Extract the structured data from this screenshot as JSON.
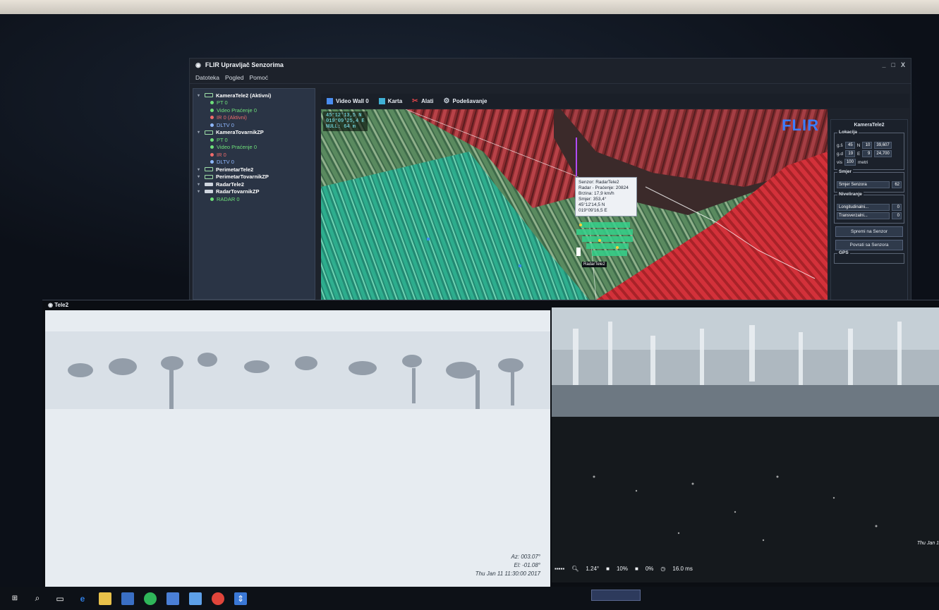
{
  "app": {
    "title": "FLIR Upravljač Senzorima",
    "menu": [
      "Datoteka",
      "Pogled",
      "Pomoć"
    ],
    "window_controls": [
      "_",
      "□",
      "X"
    ]
  },
  "tree": [
    {
      "type": "parent",
      "kind": "cam",
      "label": "KameraTele2 (Aktivni)"
    },
    {
      "type": "child",
      "color": "green",
      "label": "PT 0"
    },
    {
      "type": "child",
      "color": "green",
      "label": "Video Praćenje 0"
    },
    {
      "type": "child",
      "color": "red",
      "label": "IR 0 (Aktivni)"
    },
    {
      "type": "child",
      "color": "blue",
      "label": "DLTV 0"
    },
    {
      "type": "parent",
      "kind": "cam",
      "label": "KameraTovarnikZP"
    },
    {
      "type": "child",
      "color": "green",
      "label": "PT 0"
    },
    {
      "type": "child",
      "color": "green",
      "label": "Video Praćenje 0"
    },
    {
      "type": "child",
      "color": "red",
      "label": "IR 0"
    },
    {
      "type": "child",
      "color": "blue",
      "label": "DLTV 0"
    },
    {
      "type": "parent",
      "kind": "cam",
      "label": "PerimetarTele2"
    },
    {
      "type": "parent",
      "kind": "cam",
      "label": "PerimetarTovarnikZP"
    },
    {
      "type": "parent",
      "kind": "radar",
      "label": "RadarTele2"
    },
    {
      "type": "parent",
      "kind": "radar",
      "label": "RadarTovarnikZP"
    },
    {
      "type": "child",
      "color": "green",
      "label": "RADAR 0"
    }
  ],
  "tabs": [
    "Video Wall 0",
    "Karta",
    "Alati",
    "Podešavanje"
  ],
  "map": {
    "coords": [
      "45°12'13,5 N",
      "019°09'25,4 E",
      "NULL: 64 m"
    ],
    "logo": "FLIR",
    "tooltip": [
      "Senzor: RadarTele2",
      "Radar - Praćenje: 20824",
      "Brzina: 17,9 km/h",
      "Smjer: 353,4°",
      "45°12'14,5 N",
      "019°09'16,5 E"
    ],
    "radar_label": "RadarTele2"
  },
  "rpanel": {
    "title": "KameraTele2",
    "lokacija_label": "Lokacija",
    "lat": {
      "hemi": "g.š",
      "deg": "45",
      "dir": "N",
      "min": "10",
      "sec": "39,607"
    },
    "lon": {
      "hemi": "g.d",
      "deg": "19",
      "dir": "E",
      "min": "9",
      "sec": "24,700"
    },
    "vis": {
      "label": "vis",
      "value": "100",
      "unit": "metri"
    },
    "smjer_label": "Smjer",
    "smjer_senzora": "Smjer Senzora",
    "smjer_value": "62",
    "niveliranje_label": "Niveliranje",
    "longitudinal": "Longitudinalni...",
    "longitudinal_value": "0",
    "transverzalni": "Transverzalni...",
    "transverzalni_value": "0",
    "btn_spremi": "Spremi na Senzor",
    "btn_povrati": "Povrati sa Senzora",
    "gps_label": "GPS"
  },
  "video": {
    "title": "Tele2",
    "left_overlay": [
      "Az: 003.07°",
      "El: -01.08°",
      "Thu Jan 11 11:30:00 2017"
    ],
    "toolbar": {
      "zoom": "1.24°",
      "pct": "10%",
      "pct2": "0%",
      "time": "16.0 ms"
    },
    "right_ts": "Thu Jan 1"
  },
  "colors": {
    "accent": "#3b7dff",
    "panel": "#2a3445",
    "red_zone": "#d3313a",
    "green_zone": "#2fbf8f"
  }
}
